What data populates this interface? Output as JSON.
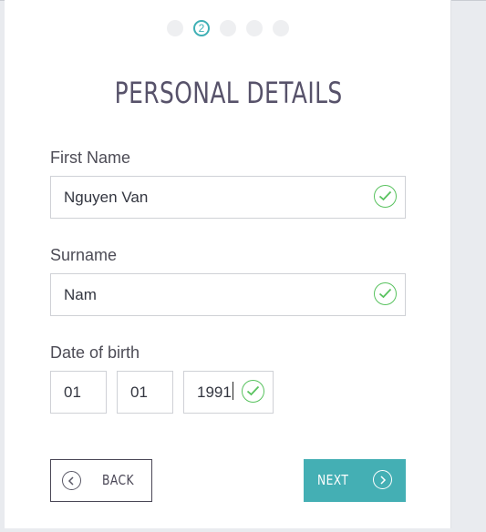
{
  "wizard": {
    "steps": [
      "",
      "2",
      "",
      "",
      ""
    ],
    "active_step": 2,
    "accent_color": "#44afb4",
    "success_color": "#58c25e"
  },
  "form": {
    "title": "PERSONAL DETAILS",
    "first_name": {
      "label": "First Name",
      "value": "Nguyen Van",
      "status": "valid"
    },
    "surname": {
      "label": "Surname",
      "value": "Nam",
      "status": "valid"
    },
    "dob": {
      "label": "Date of birth",
      "day": "01",
      "month": "01",
      "year": "1991",
      "status": "valid"
    }
  },
  "actions": {
    "back_label": "BACK",
    "next_label": "NEXT"
  }
}
